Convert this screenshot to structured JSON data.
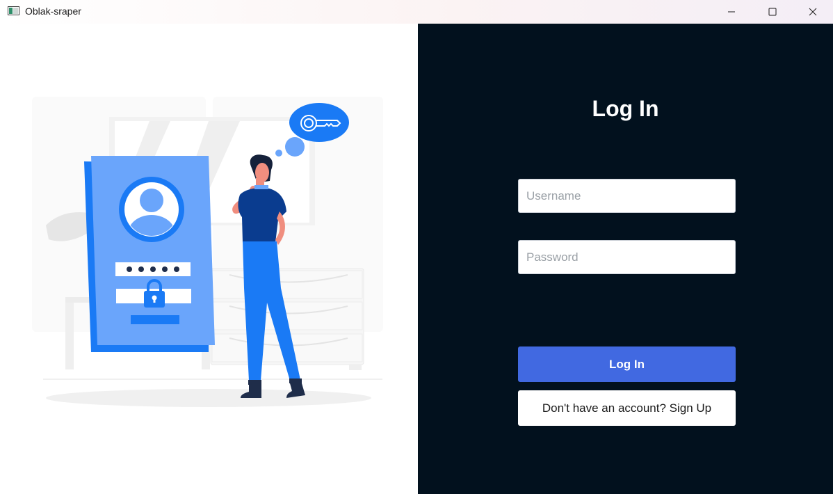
{
  "window": {
    "title": "Oblak-sraper",
    "icon": "app-window-icon",
    "controls": [
      "minimize-icon",
      "maximize-icon",
      "close-icon"
    ]
  },
  "illustration": {
    "description_icon": "login-security-illustration",
    "colors": {
      "primary_blue": "#1a7af5",
      "light_blue": "#6aa5fb",
      "dark_blue": "#0a3c8f"
    }
  },
  "login": {
    "title": "Log In",
    "username": {
      "placeholder": "Username",
      "value": ""
    },
    "password": {
      "placeholder": "Password",
      "value": ""
    },
    "login_label": "Log In",
    "signup_label": "Don't have an account? Sign Up"
  },
  "colors": {
    "panel_background": "#02111e",
    "login_button": "#4169e1",
    "signup_button": "#ffffff"
  }
}
